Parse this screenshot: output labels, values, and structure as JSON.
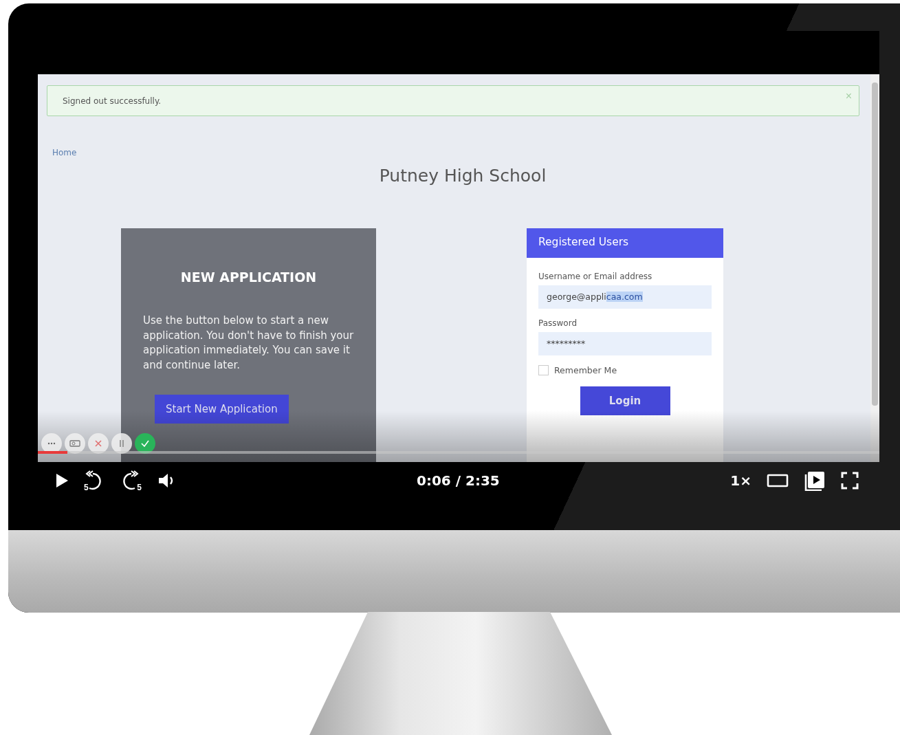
{
  "alert": {
    "text": "Signed out successfully.",
    "close": "×"
  },
  "home_link": "Home",
  "school_title": "Putney High School",
  "new_application": {
    "title": "NEW APPLICATION",
    "body": "Use the button below to start a new application. You don't have to finish your application immediately. You can save it and continue later.",
    "button": "Start New Application"
  },
  "login": {
    "header": "Registered Users",
    "username_label": "Username or Email address",
    "username_value": "george@appli",
    "username_selected": "caa.com",
    "password_label": "Password",
    "password_value": "*********",
    "remember_label": "Remember Me",
    "remember_checked": false,
    "button": "Login"
  },
  "player": {
    "playing": false,
    "progress": {
      "level": 0.035
    },
    "skip_back": "5",
    "skip_forward": "5",
    "time": "0:06 / 2:35",
    "speed": "1×"
  }
}
